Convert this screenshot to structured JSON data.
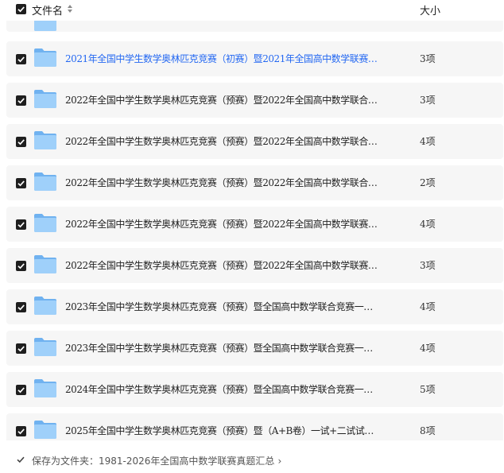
{
  "header": {
    "name_label": "文件名",
    "size_label": "大小"
  },
  "rows": [
    {
      "name": "2021年全国中学生数学奥林匹克竞赛（初赛）暨2021年全国高中数学联赛…",
      "count": "3项",
      "active": true
    },
    {
      "name": "2022年全国中学生数学奥林匹克竞赛（预赛）暨2022年全国高中数学联合…",
      "count": "3项"
    },
    {
      "name": "2022年全国中学生数学奥林匹克竞赛（预赛）暨2022年全国高中数学联合…",
      "count": "4项"
    },
    {
      "name": "2022年全国中学生数学奥林匹克竞赛（预赛）暨2022年全国高中数学联合…",
      "count": "2项"
    },
    {
      "name": "2022年全国中学生数学奥林匹克竞赛（预赛）暨2022年全国高中数学联赛…",
      "count": "4项"
    },
    {
      "name": "2022年全国中学生数学奥林匹克竞赛（预赛）暨2022年全国高中数学联赛…",
      "count": "3项"
    },
    {
      "name": "2023年全国中学生数学奥林匹克竞赛（预赛）暨全国高中数学联合竞赛一…",
      "count": "4项"
    },
    {
      "name": "2023年全国中学生数学奥林匹克竞赛（预赛）暨全国高中数学联合竞赛一…",
      "count": "4项"
    },
    {
      "name": "2024年全国中学生数学奥林匹克竞赛（预赛）暨全国高中数学联合竞赛一…",
      "count": "5项"
    },
    {
      "name": "2025年全国中学生数学奥林匹克竞赛（预赛）暨（A+B卷）一试+二试试…",
      "count": "8项"
    }
  ],
  "footer": {
    "save_prefix": "保存为文件夹：",
    "save_path": "1981-2026年全国高中数学联赛真题汇总",
    "chevron": "›"
  },
  "colors": {
    "accent": "#2468f2",
    "row_bg": "#f6f6f6",
    "checkbox": "#1f1f1f",
    "folder": "#8cc3f5"
  },
  "icons": [
    "checkbox-checked-icon",
    "sort-icon",
    "folder-icon",
    "chevron-right-icon"
  ]
}
